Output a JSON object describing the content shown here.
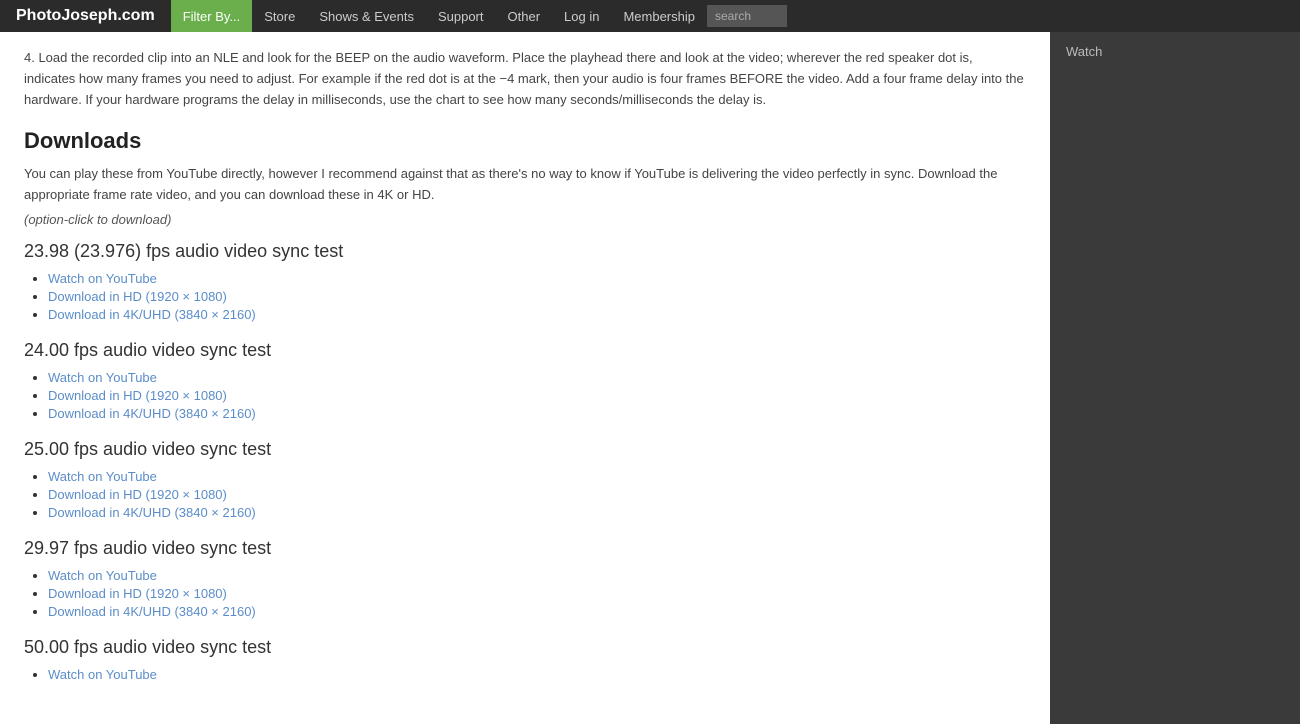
{
  "header": {
    "site_title": "PhotoJoseph.com",
    "nav_items": [
      {
        "label": "Filter By...",
        "active": true
      },
      {
        "label": "Store"
      },
      {
        "label": "Shows & Events"
      },
      {
        "label": "Support"
      },
      {
        "label": "Other"
      },
      {
        "label": "Log in"
      },
      {
        "label": "Membership"
      }
    ],
    "search_placeholder": "search"
  },
  "content": {
    "intro_text": "4. Load the recorded clip into an NLE and look for the BEEP on the audio waveform. Place the playhead there and look at the video; wherever the red speaker dot is, indicates how many frames you need to adjust. For example if the red dot is at the −4 mark, then your audio is four frames BEFORE the video. Add a four frame delay into the hardware. If your hardware programs the delay in milliseconds, use the chart to see how many seconds/milliseconds the delay is.",
    "downloads_heading": "Downloads",
    "downloads_desc": "You can play these from YouTube directly, however I recommend against that as there's no way to know if YouTube is delivering the video perfectly in sync. Download the appropriate frame rate video, and you can download these in 4K or HD.",
    "option_click_note": "(option-click to download)",
    "fps_sections": [
      {
        "title": "23.98 (23.976) fps audio video sync test",
        "links": [
          {
            "text": "Watch on YouTube",
            "href": "#"
          },
          {
            "text": "Download in HD (1920 × 1080)",
            "href": "#"
          },
          {
            "text": "Download in 4K/UHD (3840 × 2160)",
            "href": "#"
          }
        ]
      },
      {
        "title": "24.00 fps audio video sync test",
        "links": [
          {
            "text": "Watch on YouTube",
            "href": "#"
          },
          {
            "text": "Download in HD (1920 × 1080)",
            "href": "#"
          },
          {
            "text": "Download in 4K/UHD (3840 × 2160)",
            "href": "#"
          }
        ]
      },
      {
        "title": "25.00 fps audio video sync test",
        "links": [
          {
            "text": "Watch on YouTube",
            "href": "#"
          },
          {
            "text": "Download in HD (1920 × 1080)",
            "href": "#"
          },
          {
            "text": "Download in 4K/UHD (3840 × 2160)",
            "href": "#"
          }
        ]
      },
      {
        "title": "29.97 fps audio video sync test",
        "links": [
          {
            "text": "Watch on YouTube",
            "href": "#"
          },
          {
            "text": "Download in HD (1920 × 1080)",
            "href": "#"
          },
          {
            "text": "Download in 4K/UHD (3840 × 2160)",
            "href": "#"
          }
        ]
      },
      {
        "title": "50.00 fps audio video sync test",
        "links": [
          {
            "text": "Watch on YouTube",
            "href": "#"
          }
        ]
      }
    ]
  },
  "sidebar": {
    "watch_label": "Watch"
  }
}
